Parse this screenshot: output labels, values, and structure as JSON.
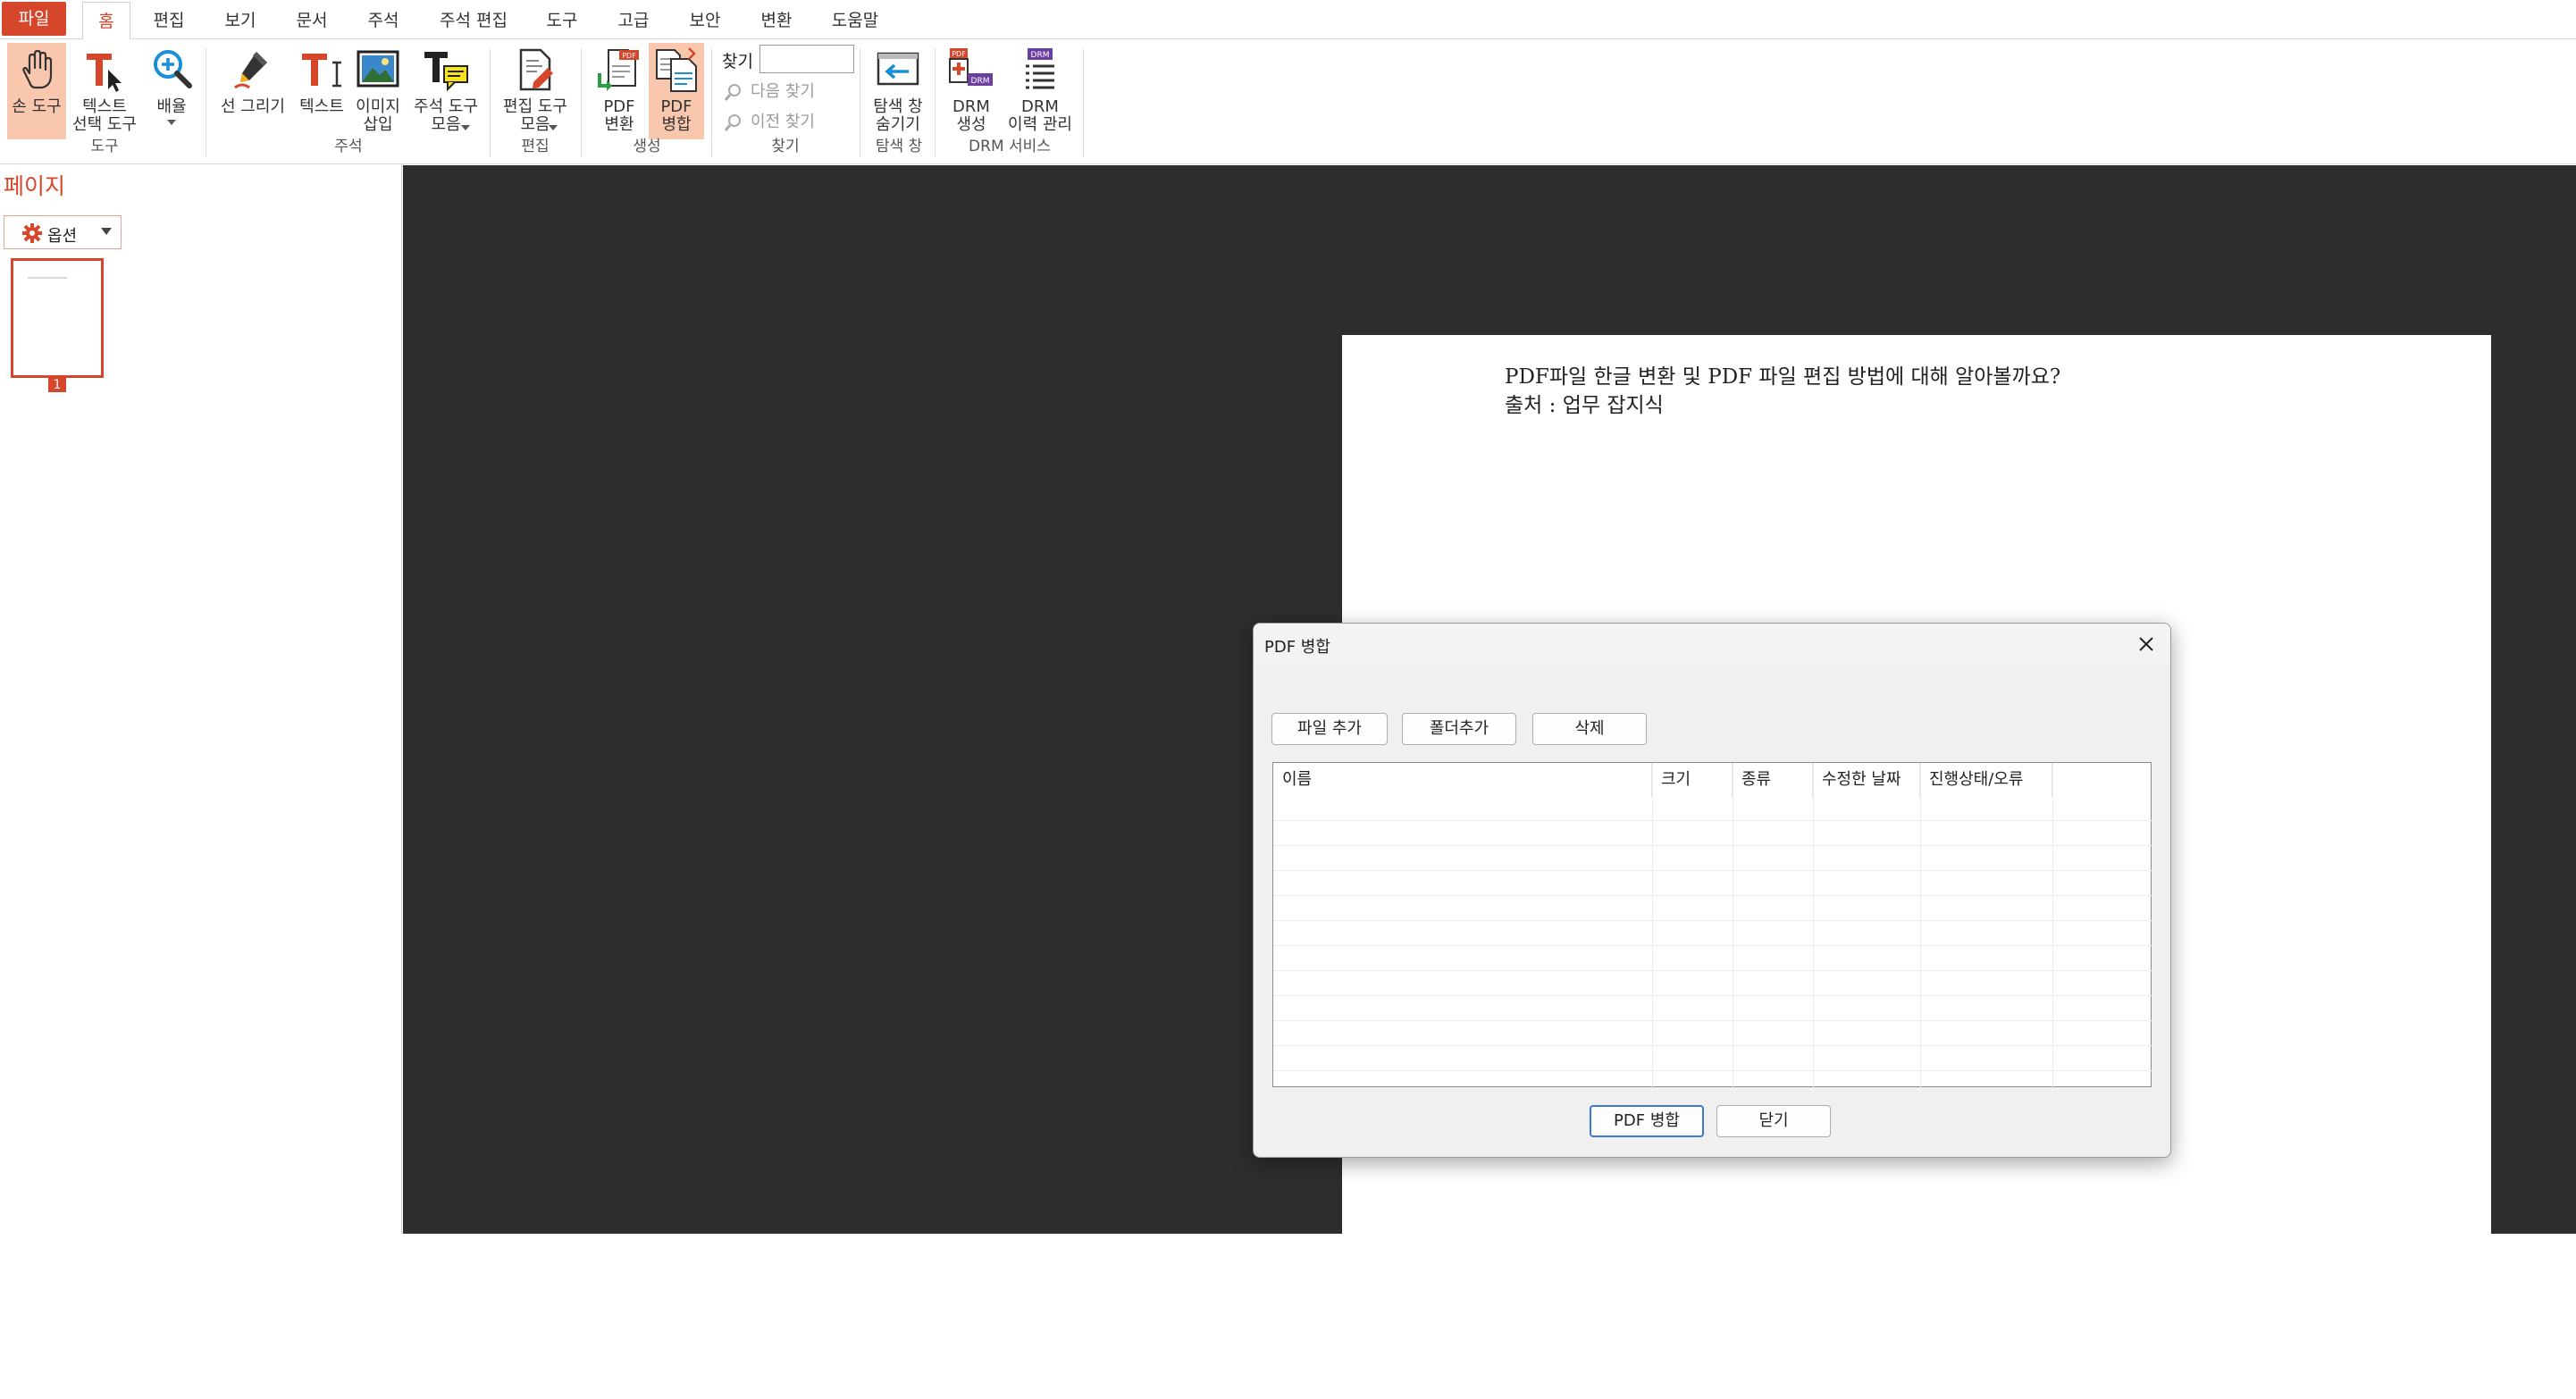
{
  "tabs": {
    "file": "파일",
    "home": "홈",
    "edit": "편집",
    "view": "보기",
    "document": "문서",
    "comment": "주석",
    "comment_edit": "주석 편집",
    "tools": "도구",
    "advanced": "고급",
    "security": "보안",
    "convert": "변환",
    "help": "도움말"
  },
  "ribbon": {
    "hand_tool": "손 도구",
    "text_select_tool": "텍스트\n선택 도구",
    "zoom": "배율",
    "group_tools": "도구",
    "draw_line": "선 그리기",
    "text": "텍스트",
    "insert_image": "이미지\n삽입",
    "comment_tools": "주석 도구\n모음",
    "group_comment": "주석",
    "edit_tools": "편집 도구\n모음",
    "group_edit": "편집",
    "pdf_convert": "PDF\n변환",
    "pdf_merge": "PDF\n병합",
    "group_create": "생성",
    "find_label": "찾기",
    "find_next": "다음 찾기",
    "find_prev": "이전 찾기",
    "group_find": "찾기",
    "hide_nav": "탐색 창\n숨기기",
    "group_nav": "탐색 창",
    "drm_create": "DRM\n생성",
    "drm_history": "DRM\n이력 관리",
    "group_drm": "DRM 서비스",
    "icon_pdf_tag": "PDF",
    "icon_drm_tag": "DRM"
  },
  "left_pane": {
    "title": "페이지",
    "options": "옵션",
    "thumb_number": "1"
  },
  "document": {
    "line1": "PDF파일 한글 변환 및 PDF 파일 편집 방법에 대해 알아볼까요?",
    "line2": "출처 : 업무 잡지식"
  },
  "dialog": {
    "title": "PDF 병합",
    "add_file": "파일 추가",
    "add_folder": "폴더추가",
    "delete": "삭제",
    "columns": {
      "name": "이름",
      "size": "크기",
      "type": "종류",
      "modified": "수정한 날짜",
      "status": "진행상태/오류"
    },
    "merge": "PDF 병합",
    "close": "닫기"
  },
  "colors": {
    "accent": "#d6462a",
    "selected_button": "#f8c7ae",
    "doc_background": "#2d2d2d",
    "primary_button_border": "#3b78d8"
  }
}
